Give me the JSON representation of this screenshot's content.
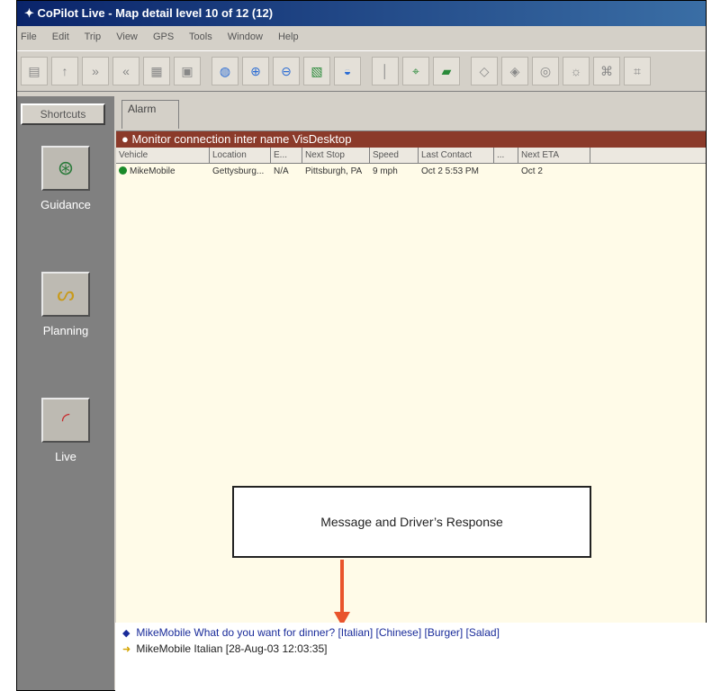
{
  "window": {
    "title": "CoPilot Live - Map detail level 10 of 12 (12)"
  },
  "menu": [
    "File",
    "Edit",
    "Trip",
    "View",
    "GPS",
    "Tools",
    "Window",
    "Help"
  ],
  "toolbar": {
    "button_count": 22
  },
  "sidebar": {
    "header": "Shortcuts",
    "items": [
      {
        "label": "Guidance",
        "icon": "steering-wheel-icon"
      },
      {
        "label": "Planning",
        "icon": "planning-icon"
      },
      {
        "label": "Live",
        "icon": "live-signal-icon"
      }
    ]
  },
  "tabs": [
    {
      "label": "Alarm"
    }
  ],
  "alert": {
    "text": "Monitor connection inter name VisDesktop"
  },
  "table": {
    "columns": [
      "Vehicle",
      "Location",
      "E...",
      "Next Stop",
      "Speed",
      "Last Contact",
      "...",
      "Next ETA"
    ],
    "rows": [
      {
        "vehicle": "MikeMobile",
        "location": "Gettysburg...",
        "e": "N/A",
        "next_stop": "Pittsburgh, PA",
        "speed": "9 mph",
        "last_contact": "Oct 2 5:53 PM",
        "x": "",
        "eta": "Oct 2"
      }
    ]
  },
  "messages": [
    {
      "sender": "MikeMobile",
      "text": "What do you want for dinner? [Italian] [Chinese] [Burger] [Salad]",
      "icon": "message-out-icon"
    },
    {
      "sender": "MikeMobile",
      "text": "Italian        [28-Aug-03 12:03:35]",
      "icon": "message-in-icon"
    }
  ],
  "callout": {
    "text": "Message and Driver’s Response"
  },
  "colors": {
    "titlebar": "#0a246a",
    "alert_bar": "#8b3a2a",
    "content_bg": "#fffbe8",
    "arrow": "#e9542c",
    "message_link": "#1a2c9a"
  }
}
